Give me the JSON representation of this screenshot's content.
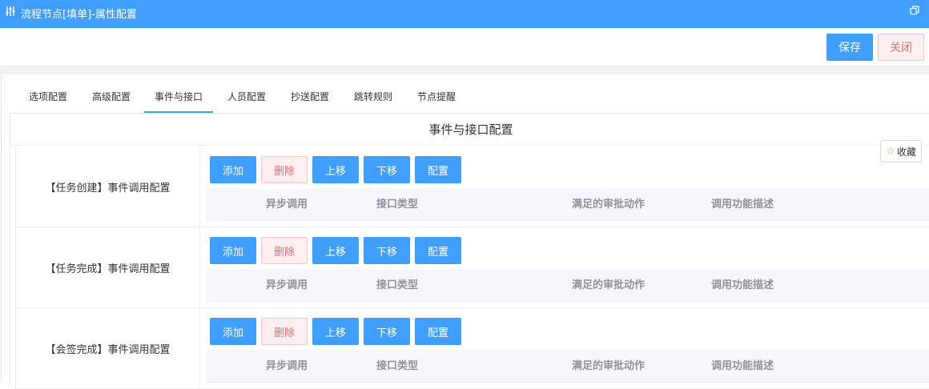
{
  "window": {
    "title": "流程节点[填单]-属性配置",
    "icon": "sliders-icon",
    "restore_icon": "restore-window-icon"
  },
  "toolbar": {
    "save_label": "保存",
    "close_label": "关闭"
  },
  "tabs": [
    {
      "label": "选项配置"
    },
    {
      "label": "高级配置"
    },
    {
      "label": "事件与接口",
      "active": true
    },
    {
      "label": "人员配置"
    },
    {
      "label": "抄送配置"
    },
    {
      "label": "跳转规则"
    },
    {
      "label": "节点提醒"
    }
  ],
  "section": {
    "title": "事件与接口配置"
  },
  "favorite": {
    "label": "收藏",
    "icon": "star-icon"
  },
  "table_headers": [
    "异步调用",
    "接口类型",
    "满足的审批动作",
    "调用功能描述"
  ],
  "row_buttons": {
    "add": "添加",
    "delete": "删除",
    "up": "上移",
    "down": "下移",
    "config": "配置"
  },
  "rows": [
    {
      "label": "【任务创建】事件调用配置"
    },
    {
      "label": "【任务完成】事件调用配置"
    },
    {
      "label": "【会签完成】事件调用配置"
    }
  ],
  "colors": {
    "primary": "#409eff",
    "danger": "#f56c6c",
    "danger_bg": "#fef0f0"
  }
}
